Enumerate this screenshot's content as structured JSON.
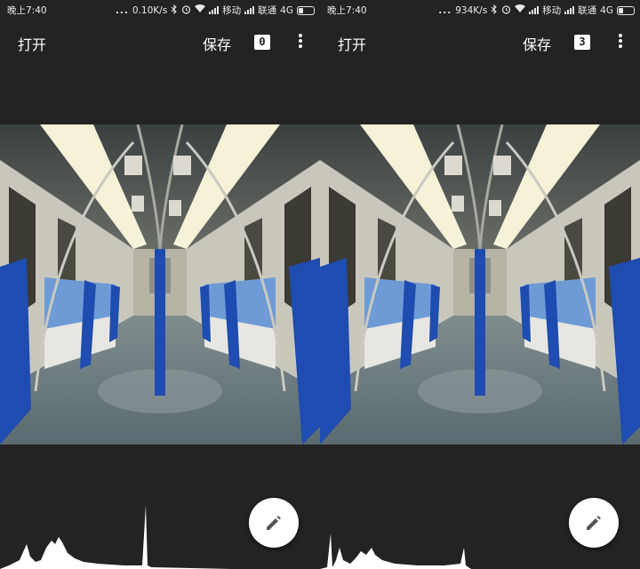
{
  "panes": [
    {
      "status": {
        "time": "晚上7:40",
        "dots": "...",
        "speed": "0.10K/s",
        "carrier1": "移动",
        "carrier2": "联通",
        "network": "4G"
      },
      "toolbar": {
        "open": "打开",
        "save": "保存",
        "count": "0"
      }
    },
    {
      "status": {
        "time": "晚上7:40",
        "dots": "...",
        "speed": "934K/s",
        "carrier1": "移动",
        "carrier2": "联通",
        "network": "4G"
      },
      "toolbar": {
        "open": "打开",
        "save": "保存",
        "count": "3"
      }
    }
  ],
  "icons": {
    "bluetooth": "bluetooth-icon",
    "alarm": "alarm-icon",
    "wifi": "wifi-icon",
    "signal": "signal-icon",
    "battery": "battery-icon",
    "more": "more-vert-icon",
    "edit": "pencil-icon"
  },
  "colors": {
    "background": "#232323",
    "seat_blue": "#1f4fa8",
    "fab": "#ffffff"
  }
}
